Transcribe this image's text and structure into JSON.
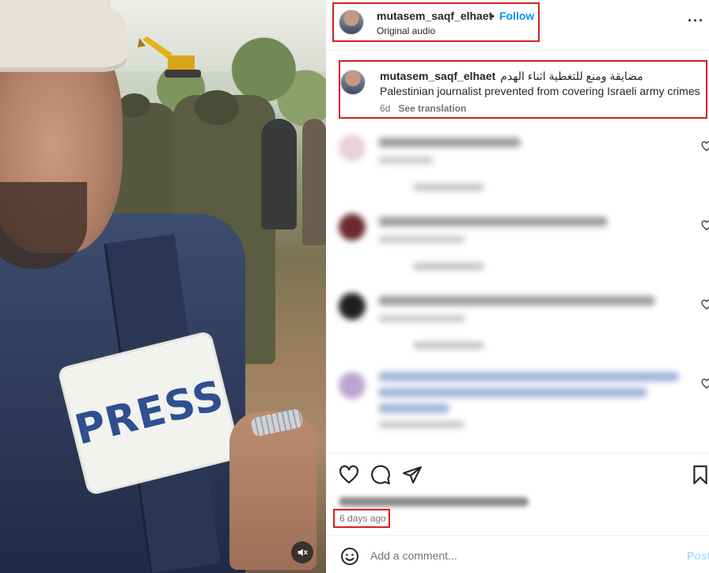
{
  "media": {
    "patch_text": "PRESS",
    "mute_icon": "speaker-muted-icon"
  },
  "post_header": {
    "username": "mutasem_saqf_elhaet",
    "separator": "•",
    "follow_label": "Follow",
    "audio_label": "Original audio",
    "more_icon": "ellipsis-icon",
    "more_glyph": "···"
  },
  "caption": {
    "username": "mutasem_saqf_elhaet",
    "text_arabic": "مضايقة ومنع للتغطية اثناء الهدم",
    "text_english": "Palestinian journalist prevented from covering Israeli army crimes",
    "age": "6d",
    "see_translation": "See translation"
  },
  "comments": {
    "blurred": true,
    "count_visible": 4,
    "avatar_colors": [
      "#e9d0dc",
      "#6b2a2f",
      "#1e1e1e",
      "#b9a5cf"
    ]
  },
  "actions": {
    "like_icon": "heart-icon",
    "comment_icon": "comment-bubble-icon",
    "share_icon": "paper-plane-icon",
    "save_icon": "bookmark-icon"
  },
  "post_meta": {
    "time_ago": "6 days ago"
  },
  "comment_bar": {
    "emoji_icon": "emoji-smile-icon",
    "placeholder": "Add a comment...",
    "post_label": "Post"
  },
  "colors": {
    "accent": "#0095f6",
    "highlight_box": "#d42020",
    "text_primary": "#262626",
    "text_secondary": "#737373"
  }
}
